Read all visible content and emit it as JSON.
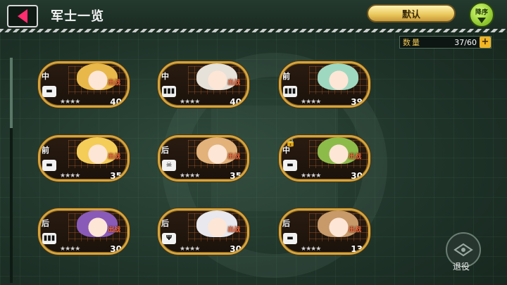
{
  "header": {
    "title": "军士一览",
    "sort_label": "默认",
    "order_label": "降序"
  },
  "count": {
    "label": "数量",
    "value": "37/60",
    "plus": "+"
  },
  "cards": [
    {
      "tag": "中",
      "type": "▬",
      "deploy": "出战",
      "stars": "★★★★",
      "level": "40",
      "hair": "#e8b84a",
      "locked": false
    },
    {
      "tag": "中",
      "type": "▮▮▮",
      "deploy": "出战",
      "stars": "★★★★",
      "level": "40",
      "hair": "#e6e2da",
      "locked": false
    },
    {
      "tag": "前",
      "type": "▮▮▮",
      "deploy": "",
      "stars": "★★★★",
      "level": "39",
      "hair": "#9fd8c0",
      "locked": false
    },
    {
      "tag": "前",
      "type": "▬",
      "deploy": "出战",
      "stars": "★★★★",
      "level": "35",
      "hair": "#f4cc58",
      "locked": false
    },
    {
      "tag": "后",
      "type": "☠",
      "deploy": "出战",
      "stars": "★★★★",
      "level": "35",
      "hair": "#e2b27a",
      "locked": false
    },
    {
      "tag": "中",
      "type": "▬",
      "deploy": "出战",
      "stars": "★★★★",
      "level": "30",
      "hair": "#8dbb4a",
      "locked": true
    },
    {
      "tag": "后",
      "type": "▮▮▮",
      "deploy": "出战",
      "stars": "★★★★",
      "level": "30",
      "hair": "#8a5ab8",
      "locked": false
    },
    {
      "tag": "后",
      "type": "Ψ",
      "deploy": "出战",
      "stars": "★★★★",
      "level": "30",
      "hair": "#e8e8ee",
      "locked": false
    },
    {
      "tag": "后",
      "type": "▬",
      "deploy": "出战",
      "stars": "★★★★",
      "level": "13",
      "hair": "#c89a6a",
      "locked": false
    }
  ],
  "retire": {
    "label": "退役",
    "icon": "retire-icon"
  },
  "colors": {
    "card_border": "#d7a43a",
    "deploy_text": "#ff6a3a",
    "back_arrow": "#ff2d6f"
  }
}
